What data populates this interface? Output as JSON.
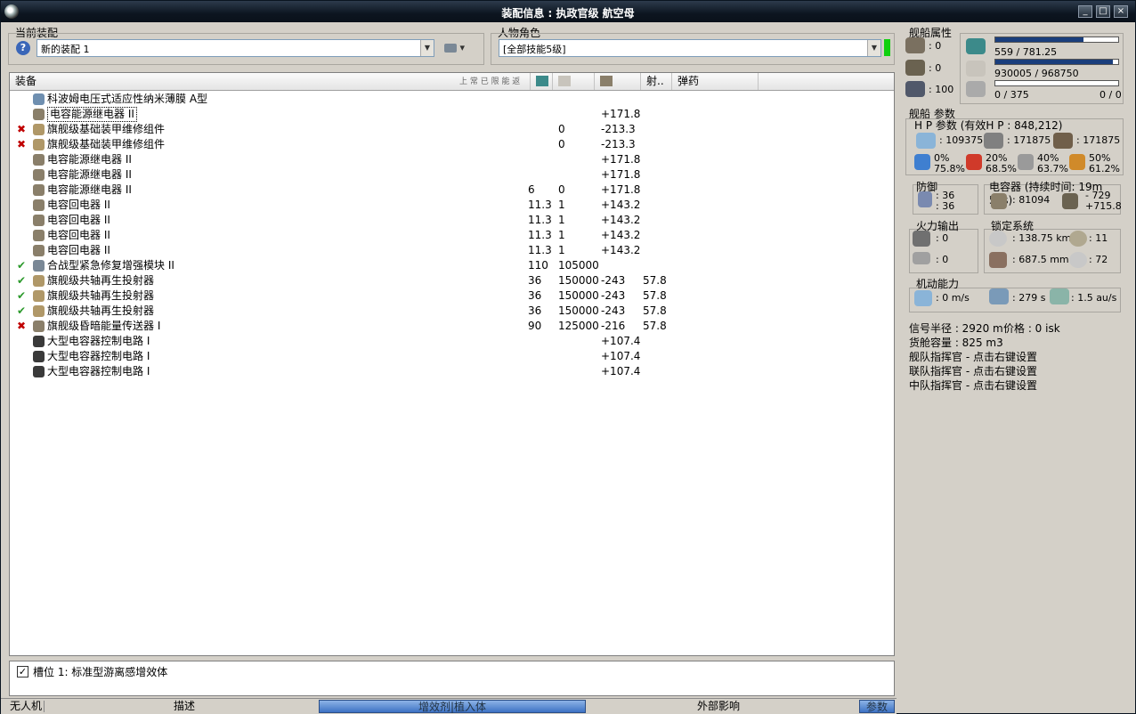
{
  "window": {
    "title": "装配信息 : 执政官级 航空母",
    "btn_min": "_",
    "btn_max": "□",
    "btn_close": "×"
  },
  "fitting": {
    "label": "当前装配",
    "value": "新的装配 1"
  },
  "character": {
    "label": "人物角色",
    "value": "[全部技能5级]"
  },
  "list": {
    "headers": {
      "equipment": "装备",
      "overlap_text": "上 常 已 限 能 返",
      "range": "射..",
      "ammo": "弹药"
    },
    "rows": [
      {
        "status": "",
        "name": "科波姆电压式适应性纳米薄膜 A型",
        "v1": "",
        "v2": "",
        "v3": "",
        "v4": "",
        "icon": "#6f8fb0"
      },
      {
        "status": "",
        "name": "电容能源继电器 II",
        "v1": "",
        "v2": "",
        "v3": "+171.8",
        "v4": "",
        "icon": "#8a7f6a",
        "sel": true
      },
      {
        "status": "x",
        "name": "旗舰级基础装甲维修组件",
        "v1": "",
        "v2": "0",
        "v3": "-213.3",
        "v4": "",
        "icon": "#b09868"
      },
      {
        "status": "x",
        "name": "旗舰级基础装甲维修组件",
        "v1": "",
        "v2": "0",
        "v3": "-213.3",
        "v4": "",
        "icon": "#b09868"
      },
      {
        "status": "",
        "name": "电容能源继电器 II",
        "v1": "",
        "v2": "",
        "v3": "+171.8",
        "v4": "",
        "icon": "#8a7f6a"
      },
      {
        "status": "",
        "name": "电容能源继电器 II",
        "v1": "",
        "v2": "",
        "v3": "+171.8",
        "v4": "",
        "icon": "#8a7f6a"
      },
      {
        "status": "",
        "name": "电容能源继电器 II",
        "v1": "6",
        "v2": "0",
        "v3": "+171.8",
        "v4": "",
        "icon": "#8a7f6a"
      },
      {
        "status": "",
        "name": "电容回电器 II",
        "v1": "11.3",
        "v2": "1",
        "v3": "+143.2",
        "v4": "",
        "icon": "#8a7f6a"
      },
      {
        "status": "",
        "name": "电容回电器 II",
        "v1": "11.3",
        "v2": "1",
        "v3": "+143.2",
        "v4": "",
        "icon": "#8a7f6a"
      },
      {
        "status": "",
        "name": "电容回电器 II",
        "v1": "11.3",
        "v2": "1",
        "v3": "+143.2",
        "v4": "",
        "icon": "#8a7f6a"
      },
      {
        "status": "",
        "name": "电容回电器 II",
        "v1": "11.3",
        "v2": "1",
        "v3": "+143.2",
        "v4": "",
        "icon": "#8a7f6a"
      },
      {
        "status": "ok",
        "name": "合战型紧急修复增强模块 II",
        "v1": "110",
        "v2": "105000",
        "v3": "",
        "v4": "",
        "icon": "#7a8896"
      },
      {
        "status": "ok",
        "name": "旗舰级共轴再生投射器",
        "v1": "36",
        "v2": "150000",
        "v3": "-243",
        "v4": "57.8",
        "icon": "#b09868"
      },
      {
        "status": "ok",
        "name": "旗舰级共轴再生投射器",
        "v1": "36",
        "v2": "150000",
        "v3": "-243",
        "v4": "57.8",
        "icon": "#b09868"
      },
      {
        "status": "ok",
        "name": "旗舰级共轴再生投射器",
        "v1": "36",
        "v2": "150000",
        "v3": "-243",
        "v4": "57.8",
        "icon": "#b09868"
      },
      {
        "status": "x",
        "name": "旗舰级昏暗能量传送器 I",
        "v1": "90",
        "v2": "125000",
        "v3": "-216",
        "v4": "57.8",
        "icon": "#8a7f6a"
      },
      {
        "status": "",
        "name": "大型电容器控制电路 I",
        "v1": "",
        "v2": "",
        "v3": "+107.4",
        "v4": "",
        "icon": "#3a3a3a"
      },
      {
        "status": "",
        "name": "大型电容器控制电路 I",
        "v1": "",
        "v2": "",
        "v3": "+107.4",
        "v4": "",
        "icon": "#3a3a3a"
      },
      {
        "status": "",
        "name": "大型电容器控制电路 I",
        "v1": "",
        "v2": "",
        "v3": "+107.4",
        "v4": "",
        "icon": "#3a3a3a"
      }
    ]
  },
  "slot": {
    "checked": "✓",
    "text": "槽位 1: 标准型游离感增效体"
  },
  "tabs": {
    "drones": "无人机",
    "description": "描述",
    "implants": "增效剂|植入体",
    "external": "外部影响",
    "params": "参数"
  },
  "ship_attrs": {
    "label": "舰船属性",
    "turret": ": 0",
    "launcher": ": 0",
    "calibration": ": 100",
    "cpu": "559 / 781.25",
    "cpu_frac": 0.716,
    "power": "930005 / 968750",
    "power_frac": 0.96,
    "drone_bw": "0 / 375",
    "drone_bay": "0 / 0",
    "drone_frac": 0.0
  },
  "ship_params": {
    "label": "舰船 参数"
  },
  "hp": {
    "title": "H P 参数 (有效H P :  848,212)",
    "shield": ": 109375",
    "armor": ": 171875",
    "structure": ": 171875",
    "em_a": "0%",
    "em_b": "75.8%",
    "th_a": "20%",
    "th_b": "68.5%",
    "ki_a": "40%",
    "ki_b": "63.7%",
    "ex_a": "50%",
    "ex_b": "61.2%"
  },
  "defense": {
    "label": "防御",
    "v1": ": 36",
    "v2": ": 36"
  },
  "capacitor": {
    "label": "电容器 (持续时间: 19m 58s)",
    "cap": ": 81094",
    "delta1": "- 729",
    "delta2": "+715.8"
  },
  "firepower": {
    "label": "火力输出",
    "v1": ": 0",
    "v2": ": 0"
  },
  "targeting": {
    "label": "锁定系统",
    "range": ": 138.75 km",
    "max_targets": ": 11",
    "scan_res": ": 687.5 mm",
    "sensor": ": 72"
  },
  "mobility": {
    "label": "机动能力",
    "speed": ": 0 m/s",
    "align": ": 279 s",
    "warp": ": 1.5 au/s"
  },
  "misc": {
    "sig": "信号半径 : 2920 m",
    "price": "价格 : 0 isk",
    "cargo": "货舱容量 : 825 m3",
    "fleet": "舰队指挥官 - 点击右键设置",
    "wing": "联队指挥官 - 点击右键设置",
    "squad": "中队指挥官 - 点击右键设置"
  }
}
